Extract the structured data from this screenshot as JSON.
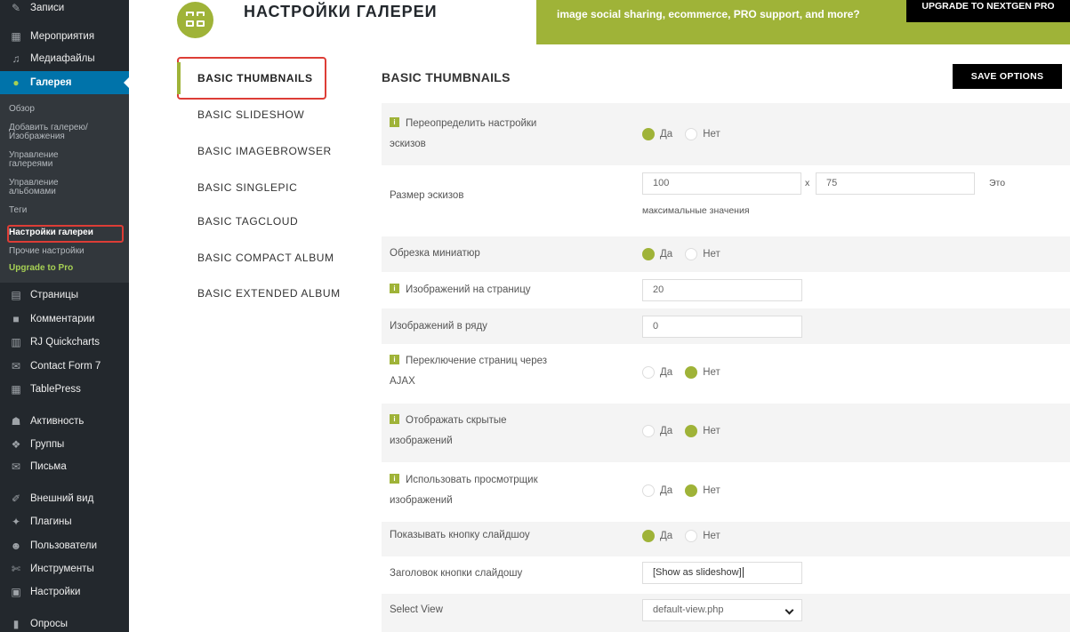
{
  "sidebar": {
    "items": [
      {
        "icon": "pin-icon",
        "glyph": "✎",
        "label": "Записи"
      },
      {
        "icon": "calendar-icon",
        "glyph": "▦",
        "label": "Мероприятия"
      },
      {
        "icon": "media-icon",
        "glyph": "♫",
        "label": "Медиафайлы"
      },
      {
        "icon": "gallery-icon",
        "glyph": "●",
        "label": "Галерея"
      },
      {
        "icon": "pages-icon",
        "glyph": "▤",
        "label": "Страницы"
      },
      {
        "icon": "comments-icon",
        "glyph": "■",
        "label": "Комментарии"
      },
      {
        "icon": "chart-icon",
        "glyph": "▥",
        "label": "RJ Quickcharts"
      },
      {
        "icon": "mail-icon",
        "glyph": "✉",
        "label": "Contact Form 7"
      },
      {
        "icon": "table-icon",
        "glyph": "▦",
        "label": "TablePress"
      },
      {
        "icon": "activity-icon",
        "glyph": "☗",
        "label": "Активность"
      },
      {
        "icon": "groups-icon",
        "glyph": "❖",
        "label": "Группы"
      },
      {
        "icon": "messages-icon",
        "glyph": "✉",
        "label": "Письма"
      },
      {
        "icon": "appearance-icon",
        "glyph": "✐",
        "label": "Внешний вид"
      },
      {
        "icon": "plugins-icon",
        "glyph": "✦",
        "label": "Плагины"
      },
      {
        "icon": "users-icon",
        "glyph": "☻",
        "label": "Пользователи"
      },
      {
        "icon": "tools-icon",
        "glyph": "✄",
        "label": "Инструменты"
      },
      {
        "icon": "settings-icon",
        "glyph": "▣",
        "label": "Настройки"
      },
      {
        "icon": "polls-icon",
        "glyph": "▮",
        "label": "Опросы"
      }
    ],
    "submenu": [
      "Обзор",
      "Добавить галерею/",
      "Изображения",
      "Управление",
      "галереями",
      "Управление",
      "альбомами",
      "Теги",
      "Настройки галереи",
      "Прочие настройки",
      "Upgrade to Pro"
    ]
  },
  "header": {
    "title": "НАСТРОЙКИ ГАЛЕРЕИ",
    "promo_text": "image social sharing, ecommerce, PRO support, and more?",
    "upgrade_label": "UPGRADE TO NEXTGEN PRO"
  },
  "tabs": [
    "BASIC THUMBNAILS",
    "BASIC SLIDESHOW",
    "BASIC IMAGEBROWSER",
    "BASIC SINGLEPIC",
    "BASIC TAGCLOUD",
    "BASIC COMPACT ALBUM",
    "BASIC EXTENDED ALBUM"
  ],
  "main": {
    "section_title": "BASIC THUMBNAILS",
    "save_label": "SAVE OPTIONS",
    "info_glyph": "i",
    "yes": "Да",
    "no": "Нет",
    "rows": {
      "override": {
        "line1": "Переопределить настройки",
        "line2": "эскизов",
        "value": "Да"
      },
      "size": {
        "label": "Размер эскизов",
        "width": "100",
        "times": "x",
        "height": "75",
        "note_a": "Это",
        "note_b": "максимальные значения"
      },
      "crop": {
        "label": "Обрезка миниатюр",
        "value": "Да"
      },
      "per_page": {
        "label": "Изображений на страницу",
        "value": "20"
      },
      "per_row": {
        "label": "Изображений в ряду",
        "value": "0"
      },
      "ajax": {
        "line1": "Переключение страниц через",
        "line2": "AJAX",
        "value": "Нет"
      },
      "hidden": {
        "line1": "Отображать скрытые",
        "line2": "изображений",
        "value": "Нет"
      },
      "viewer": {
        "line1": "Использовать просмотрщик",
        "line2": "изображений",
        "value": "Нет"
      },
      "slideshow_btn": {
        "label": "Показывать кнопку слайдшоу",
        "value": "Да"
      },
      "slideshow_title": {
        "label": "Заголовок кнопки слайдошу",
        "value": "[Show as slideshow]"
      },
      "select_view": {
        "label": "Select View",
        "value": "default-view.php"
      }
    }
  },
  "colors": {
    "accent_green": "#9fb338",
    "sidebar_bg": "#23282d",
    "sidebar_active": "#0073aa",
    "highlight_red": "#dd3d36"
  }
}
